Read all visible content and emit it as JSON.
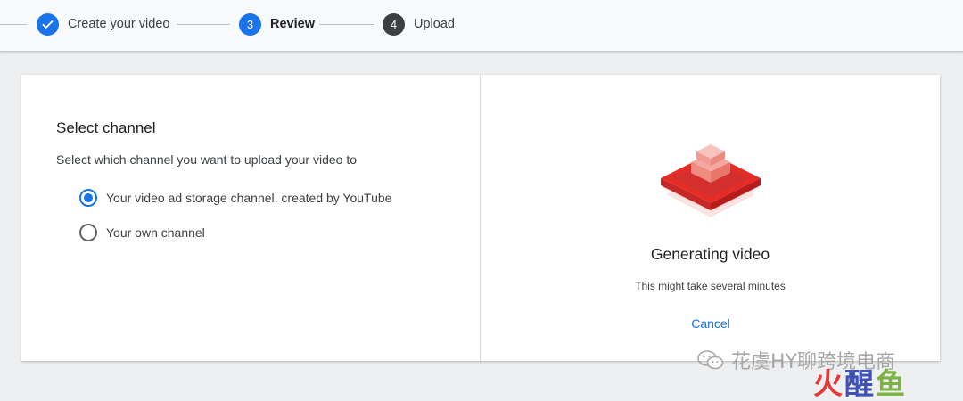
{
  "stepper": {
    "steps": [
      {
        "label": "Create your video",
        "state": "done",
        "number": ""
      },
      {
        "label": "Review",
        "state": "active",
        "number": "3"
      },
      {
        "label": "Upload",
        "state": "pending",
        "number": "4"
      }
    ]
  },
  "channel_panel": {
    "title": "Select channel",
    "description": "Select which channel you want to upload your video to",
    "options": [
      {
        "label": "Your video ad storage channel, created by YouTube",
        "selected": true
      },
      {
        "label": "Your own channel",
        "selected": false
      }
    ]
  },
  "generating_panel": {
    "title": "Generating video",
    "subtitle": "This might take several minutes",
    "cancel_label": "Cancel"
  },
  "watermark": {
    "text": "花虞HY聊跨境电商",
    "brand": [
      "火",
      "醒",
      "鱼"
    ]
  },
  "colors": {
    "accent": "#1a73e8",
    "pending_step": "#3c4043",
    "illustration_red": "#e52d27"
  },
  "icons": [
    "check-icon",
    "video-stack-illustration",
    "wechat-icon"
  ]
}
